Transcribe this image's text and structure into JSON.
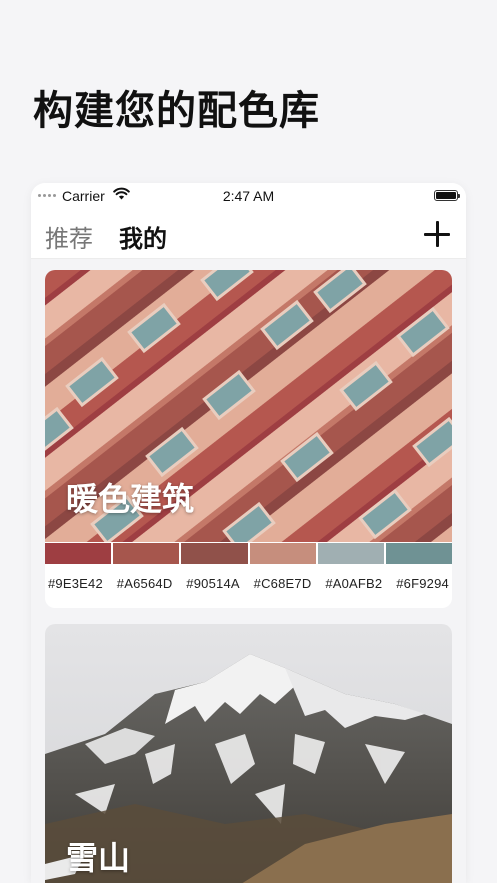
{
  "headline": "构建您的配色库",
  "status_bar": {
    "carrier": "Carrier",
    "time": "2:47 AM"
  },
  "tabs": {
    "recommend": "推荐",
    "mine": "我的"
  },
  "cards": [
    {
      "title": "暖色建筑",
      "palette": [
        {
          "hex": "#9E3E42",
          "label": "#9E3E42"
        },
        {
          "hex": "#A6564D",
          "label": "#A6564D"
        },
        {
          "hex": "#90514A",
          "label": "#90514A"
        },
        {
          "hex": "#C68E7D",
          "label": "#C68E7D"
        },
        {
          "hex": "#A0AFB2",
          "label": "#A0AFB2"
        },
        {
          "hex": "#6F9294",
          "label": "#6F9294"
        }
      ]
    },
    {
      "title": "雪山"
    }
  ]
}
